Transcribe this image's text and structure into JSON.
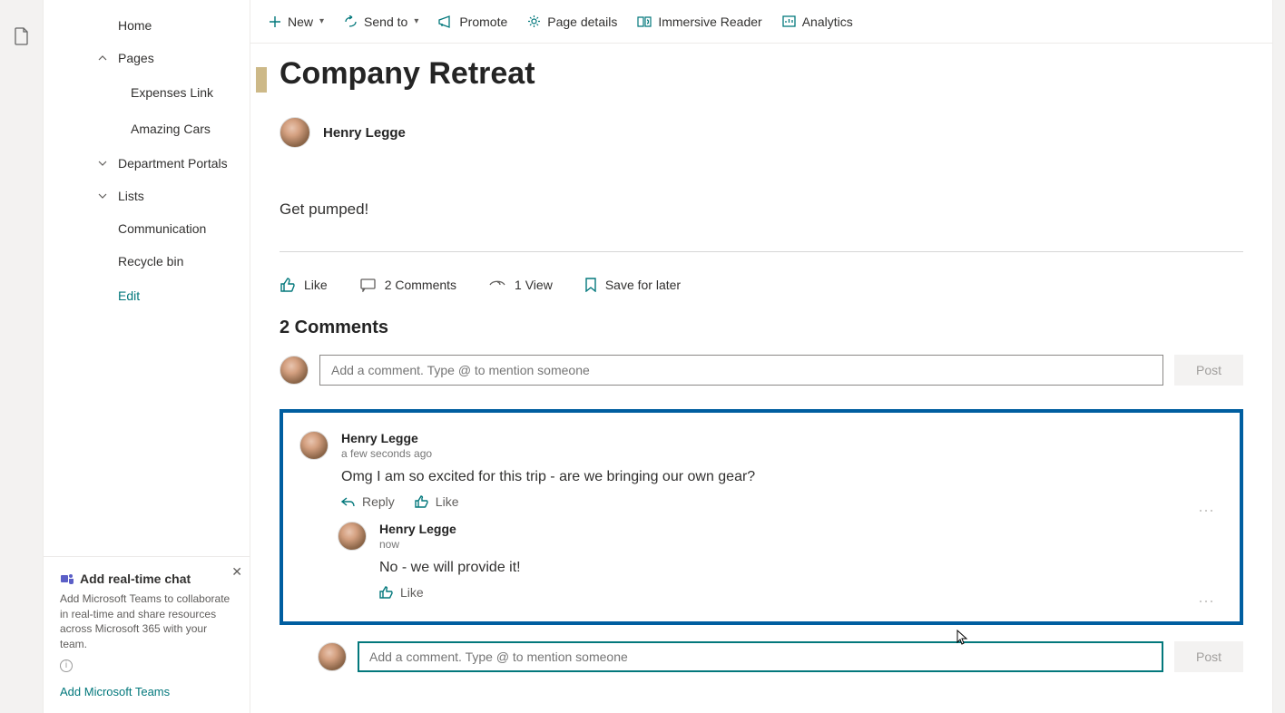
{
  "sidebar": {
    "home": "Home",
    "pages": "Pages",
    "pages_children": [
      "Expenses Link",
      "Amazing Cars"
    ],
    "dept": "Department Portals",
    "lists": "Lists",
    "communication": "Communication",
    "recycle": "Recycle bin",
    "edit": "Edit"
  },
  "promo": {
    "title": "Add real-time chat",
    "desc": "Add Microsoft Teams to collaborate in real-time and share resources across Microsoft 365 with your team.",
    "link": "Add Microsoft Teams"
  },
  "toolbar": {
    "new": "New",
    "send": "Send to",
    "promote": "Promote",
    "details": "Page details",
    "reader": "Immersive Reader",
    "analytics": "Analytics"
  },
  "page": {
    "title": "Company Retreat",
    "author": "Henry Legge",
    "body": "Get pumped!"
  },
  "stats": {
    "like": "Like",
    "comments": "2 Comments",
    "views": "1 View",
    "save": "Save for later"
  },
  "comments": {
    "heading": "2 Comments",
    "placeholder": "Add a comment. Type @ to mention someone",
    "post": "Post",
    "reply": "Reply",
    "like": "Like",
    "list": [
      {
        "author": "Henry Legge",
        "time": "a few seconds ago",
        "text": "Omg I am so excited for this trip - are we bringing our own gear?"
      },
      {
        "author": "Henry Legge",
        "time": "now",
        "text": "No - we will provide it!"
      }
    ]
  }
}
